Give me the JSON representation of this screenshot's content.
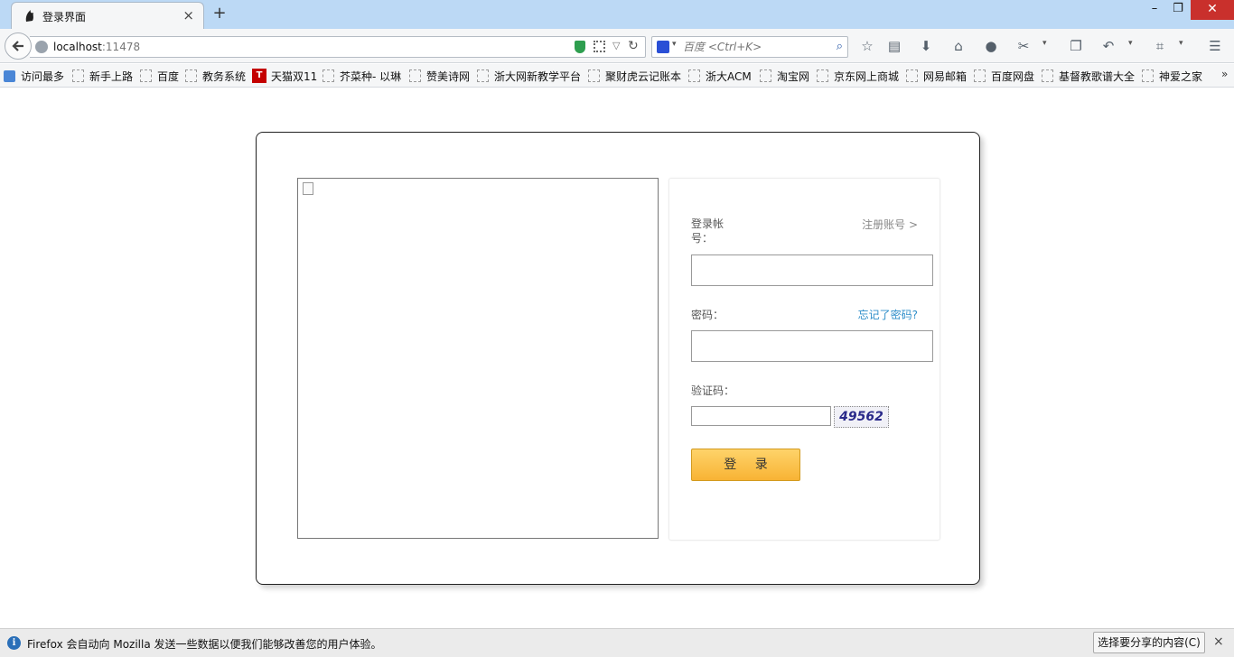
{
  "browser": {
    "tab_title": "登录界面",
    "tab_close": "×",
    "new_tab": "+",
    "window_controls": {
      "minimize": "–",
      "restore": "❐",
      "close": "✕"
    },
    "url": {
      "host": "localhost",
      "port": ":11478"
    },
    "search": {
      "placeholder": "百度 <Ctrl+K>"
    },
    "bookmarks": [
      {
        "label": "访问最多",
        "icon": "most-visited-icon"
      },
      {
        "label": "新手上路",
        "icon": "bookmark-icon"
      },
      {
        "label": "百度",
        "icon": "bookmark-icon"
      },
      {
        "label": "教务系统",
        "icon": "bookmark-icon"
      },
      {
        "label": "天猫双11",
        "icon": "tmall-icon"
      },
      {
        "label": "芥菜种- 以琳",
        "icon": "bookmark-icon"
      },
      {
        "label": "赞美诗网",
        "icon": "bookmark-icon"
      },
      {
        "label": "浙大网新教学平台",
        "icon": "bookmark-icon"
      },
      {
        "label": "聚财虎云记账本",
        "icon": "bookmark-icon"
      },
      {
        "label": "浙大ACM",
        "icon": "bookmark-icon"
      },
      {
        "label": "淘宝网",
        "icon": "bookmark-icon"
      },
      {
        "label": "京东网上商城",
        "icon": "bookmark-icon"
      },
      {
        "label": "网易邮箱",
        "icon": "bookmark-icon"
      },
      {
        "label": "百度网盘",
        "icon": "bookmark-icon"
      },
      {
        "label": "基督教歌谱大全",
        "icon": "bookmark-icon"
      },
      {
        "label": "神爱之家",
        "icon": "bookmark-icon"
      }
    ],
    "tmall_icon_letter": "T",
    "bookmarks_overflow": "»"
  },
  "login": {
    "account_label": "登录帐号：",
    "register_link": "注册账号 >",
    "account_value": "",
    "password_label": "密码：",
    "forgot_link": "忘记了密码?",
    "password_value": "",
    "captcha_label": "验证码：",
    "captcha_value": "",
    "captcha_code": "49562",
    "submit_label": "登 录"
  },
  "notification": {
    "info_glyph": "i",
    "text": "Firefox 会自动向 Mozilla 发送一些数据以便我们能够改善您的用户体验。",
    "button_label": "选择要分享的内容(C)",
    "close": "×"
  },
  "colors": {
    "tabstrip": "#bcd9f5",
    "login_button": "#f8b334",
    "forgot_link": "#2e8ec9",
    "captcha_text": "#2a2a8a"
  }
}
